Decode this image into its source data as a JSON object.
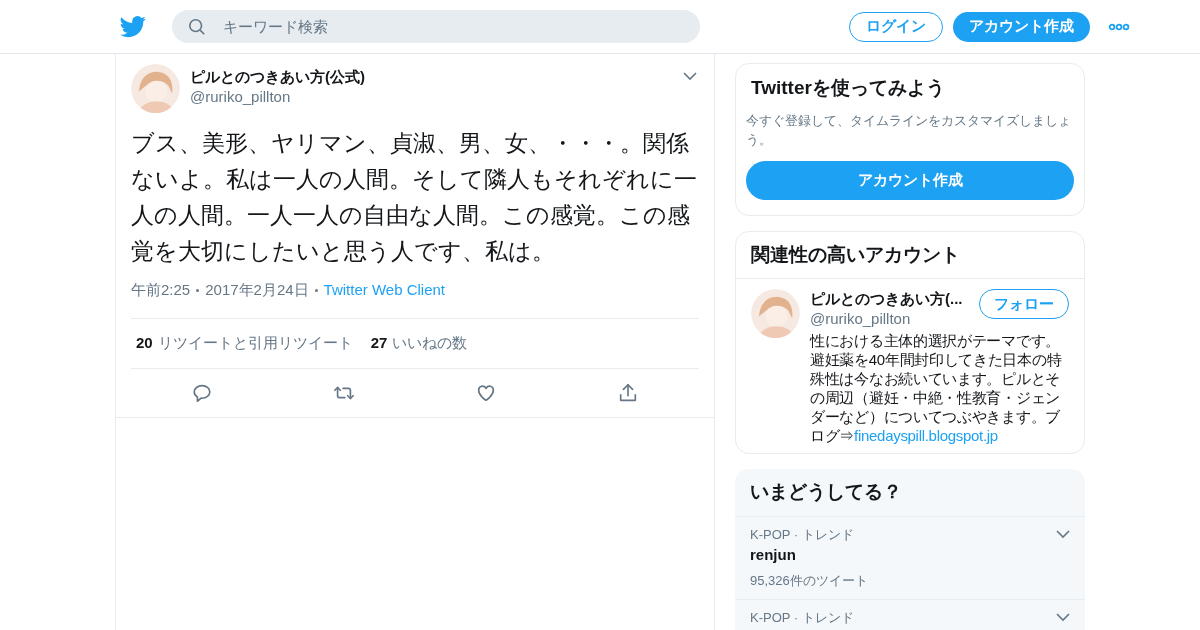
{
  "header": {
    "search": {
      "placeholder": "キーワード検索"
    },
    "login": "ログイン",
    "signup": "アカウント作成"
  },
  "tweet": {
    "name": "ピルとのつきあい方(公式)",
    "handle": "@ruriko_pillton",
    "text": "ブス、美形、ヤリマン、貞淑、男、女、・・・。関係ないよ。私は一人の人間。そして隣人もそれぞれに一人の人間。一人一人の自由な人間。この感覚。この感覚を大切にしたいと思う人です、私は。",
    "time": "午前2:25",
    "date": "2017年2月24日",
    "client": "Twitter Web Client",
    "stats": [
      {
        "count": "20",
        "label": "リツイートと引用リツイート"
      },
      {
        "count": "27",
        "label": "いいねの数"
      }
    ]
  },
  "signup_card": {
    "title": "Twitterを使ってみよう",
    "text": "今すぐ登録して、タイムラインをカスタマイズしましょう。",
    "button": "アカウント作成"
  },
  "related": {
    "title": "関連性の高いアカウント",
    "accounts": [
      {
        "name": "ピルとのつきあい方(...",
        "handle": "@ruriko_pillton",
        "follow": "フォロー",
        "bio": "性における主体的選択がテーマです。避妊薬を40年間封印してきた日本の特殊性は今なお続いています。ピルとその周辺（避妊・中絶・性教育・ジェンダーなど）についてつぶやきます。ブログ⇒",
        "link": "finedayspill.blogspot.jp"
      }
    ]
  },
  "trends": {
    "title": "いまどうしてる？",
    "items": [
      {
        "context": "K-POP · トレンド",
        "name": "renjun",
        "count": "95,326件のツイート"
      },
      {
        "context": "K-POP · トレンド"
      }
    ]
  }
}
